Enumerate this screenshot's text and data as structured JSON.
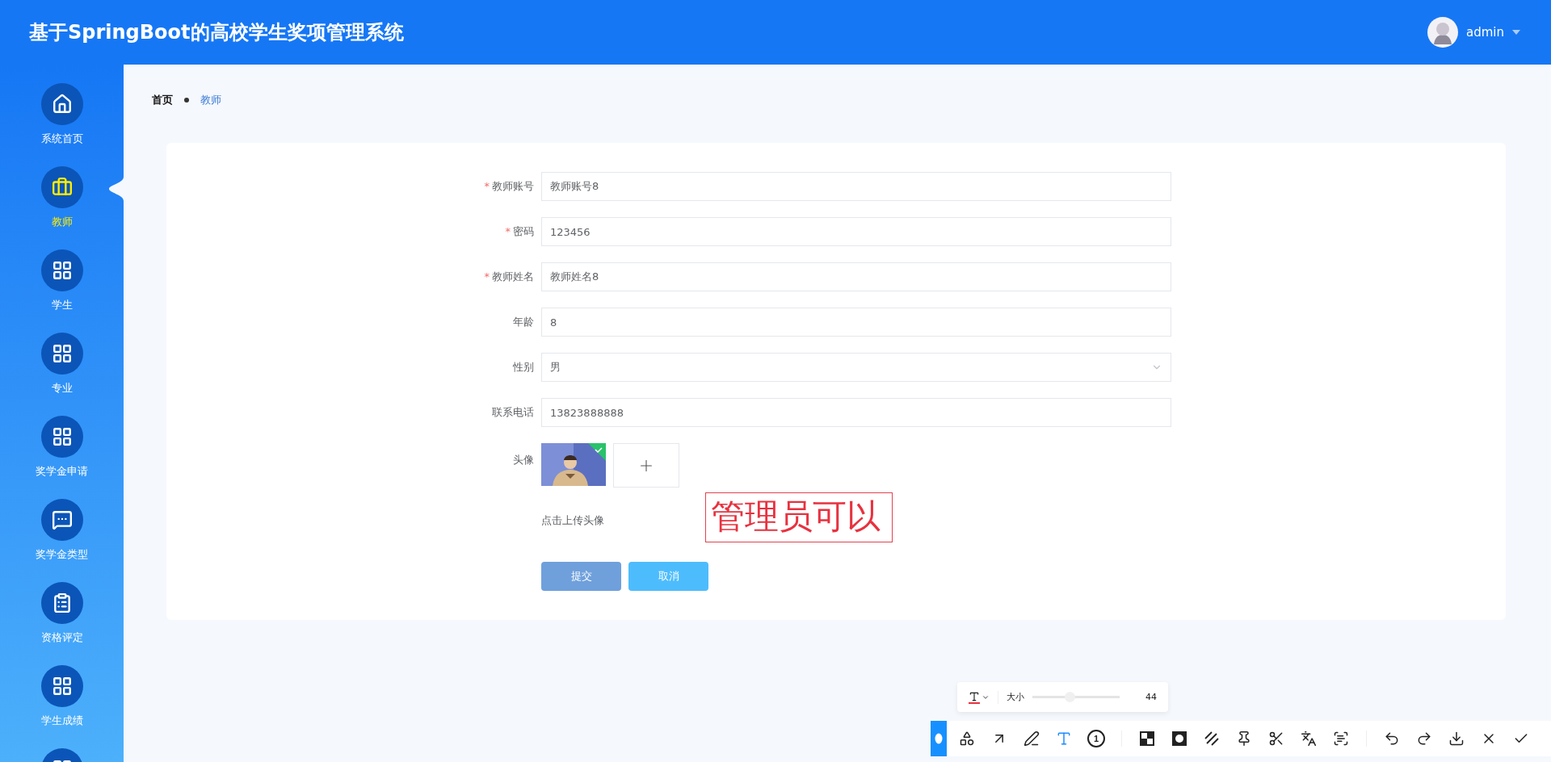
{
  "header": {
    "title": "基于SpringBoot的高校学生奖项管理系统",
    "user": "admin"
  },
  "sidebar": {
    "items": [
      {
        "label": "系统首页",
        "kind": "home",
        "selected": false
      },
      {
        "label": "教师",
        "kind": "briefcase",
        "selected": true
      },
      {
        "label": "学生",
        "kind": "grid",
        "selected": false
      },
      {
        "label": "专业",
        "kind": "grid",
        "selected": false
      },
      {
        "label": "奖学金申请",
        "kind": "grid",
        "selected": false
      },
      {
        "label": "奖学金类型",
        "kind": "chat",
        "selected": false
      },
      {
        "label": "资格评定",
        "kind": "clipboard",
        "selected": false
      },
      {
        "label": "学生成绩",
        "kind": "grid",
        "selected": false
      },
      {
        "kind": "grid",
        "selected": false
      }
    ]
  },
  "breadcrumb": [
    {
      "label": "首页",
      "selected": false
    },
    {
      "label": "教师",
      "selected": true
    }
  ],
  "form": {
    "fields": [
      {
        "label": "教师账号",
        "mark": "*",
        "value": "教师账号8",
        "kind": "text"
      },
      {
        "label": "密码",
        "mark": "*",
        "value": "123456",
        "kind": "text"
      },
      {
        "label": "教师姓名",
        "mark": "*",
        "value": "教师姓名8",
        "kind": "text"
      },
      {
        "label": "年龄",
        "value": "8",
        "kind": "text"
      },
      {
        "label": "性别",
        "value": "男",
        "kind": "select"
      },
      {
        "label": "联系电话",
        "value": "13823888888",
        "kind": "text"
      }
    ],
    "avatar": {
      "label": "头像",
      "hint": "点击上传头像",
      "uploaded": true
    },
    "buttons": [
      {
        "label": "提交",
        "kind": "primary"
      },
      {
        "label": "取消",
        "kind": "secondary"
      }
    ]
  },
  "annotation": {
    "text": "管理员可以"
  },
  "capture_toolbar": {
    "text_options": {
      "size_label": "大小",
      "level": 0.42,
      "size": "44"
    },
    "tools": [
      {
        "kind": "shape",
        "selected": false
      },
      {
        "kind": "arrow",
        "selected": false
      },
      {
        "kind": "pen",
        "selected": false
      },
      {
        "kind": "text",
        "selected": true
      },
      {
        "kind": "number",
        "glyph": "1",
        "selected": false
      },
      {
        "kind": "mosaic",
        "selected": false
      },
      {
        "kind": "blur",
        "selected": false
      },
      {
        "kind": "hatch",
        "selected": false
      },
      {
        "kind": "pin",
        "selected": false
      },
      {
        "kind": "cut",
        "selected": false
      },
      {
        "kind": "translate",
        "selected": false
      },
      {
        "kind": "ocr",
        "selected": false
      },
      {
        "kind": "undo",
        "selected": false
      },
      {
        "kind": "redo",
        "selected": false
      },
      {
        "kind": "save",
        "selected": false
      },
      {
        "kind": "close",
        "selected": false
      },
      {
        "kind": "done",
        "selected": false
      }
    ]
  }
}
